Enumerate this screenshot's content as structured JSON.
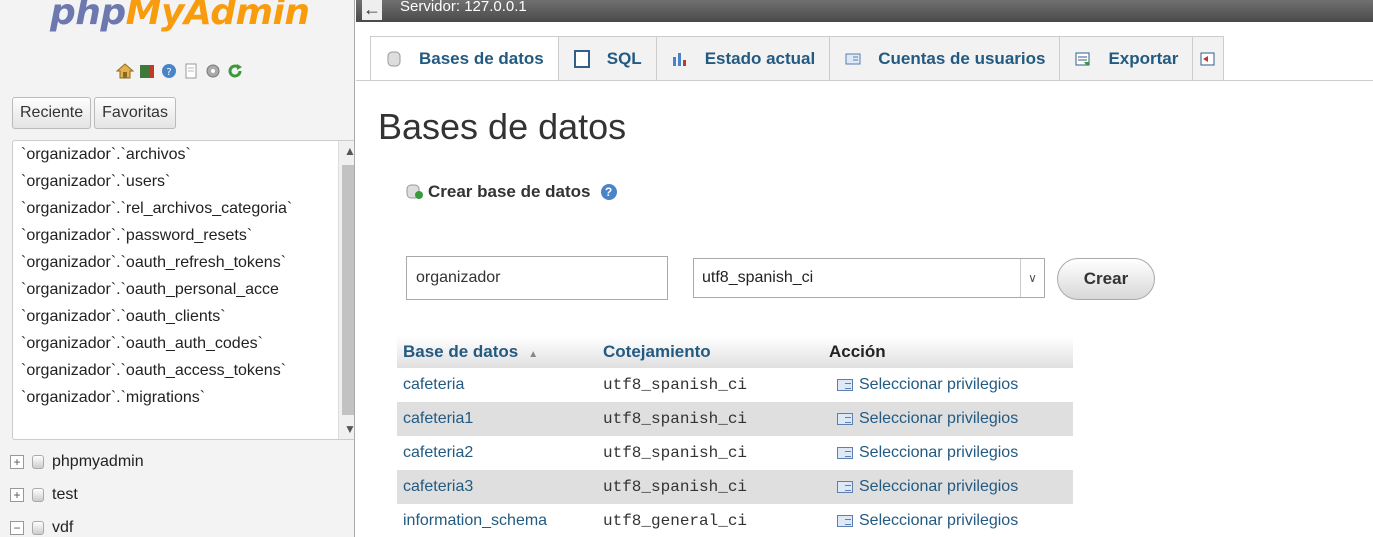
{
  "logo": {
    "part1": "php",
    "part2": "MyAdmin"
  },
  "nav_icons": [
    "home-icon",
    "exit-icon",
    "help-icon",
    "docs-icon",
    "settings-icon",
    "reload-icon"
  ],
  "recent": {
    "tabs": [
      "Reciente",
      "Favoritas"
    ],
    "items": [
      "`organizador`.`archivos`",
      "`organizador`.`users`",
      "`organizador`.`rel_archivos_categoria`",
      "`organizador`.`password_resets`",
      "`organizador`.`oauth_refresh_tokens`",
      "`organizador`.`oauth_personal_acce",
      "`organizador`.`oauth_clients`",
      "`organizador`.`oauth_auth_codes`",
      "`organizador`.`oauth_access_tokens`",
      "`organizador`.`migrations`"
    ]
  },
  "tree": [
    "phpmyadmin",
    "test",
    "vdf"
  ],
  "server_bar": {
    "label": "Servidor: 127.0.0.1"
  },
  "tabs": [
    {
      "label": "Bases de datos",
      "icon": "database-icon"
    },
    {
      "label": "SQL",
      "icon": "sql-icon"
    },
    {
      "label": "Estado actual",
      "icon": "status-icon"
    },
    {
      "label": "Cuentas de usuarios",
      "icon": "users-icon"
    },
    {
      "label": "Exportar",
      "icon": "export-icon"
    }
  ],
  "page_title": "Bases de datos",
  "create": {
    "heading": "Crear base de datos",
    "name_value": "organizador",
    "collation_value": "utf8_spanish_ci",
    "button_label": "Crear"
  },
  "table": {
    "headers": [
      "Base de datos",
      "Cotejamiento",
      "Acción"
    ],
    "rows": [
      {
        "name": "cafeteria",
        "collation": "utf8_spanish_ci",
        "action": "Seleccionar privilegios"
      },
      {
        "name": "cafeteria1",
        "collation": "utf8_spanish_ci",
        "action": "Seleccionar privilegios"
      },
      {
        "name": "cafeteria2",
        "collation": "utf8_spanish_ci",
        "action": "Seleccionar privilegios"
      },
      {
        "name": "cafeteria3",
        "collation": "utf8_spanish_ci",
        "action": "Seleccionar privilegios"
      },
      {
        "name": "information_schema",
        "collation": "utf8_general_ci",
        "action": "Seleccionar privilegios"
      }
    ]
  }
}
